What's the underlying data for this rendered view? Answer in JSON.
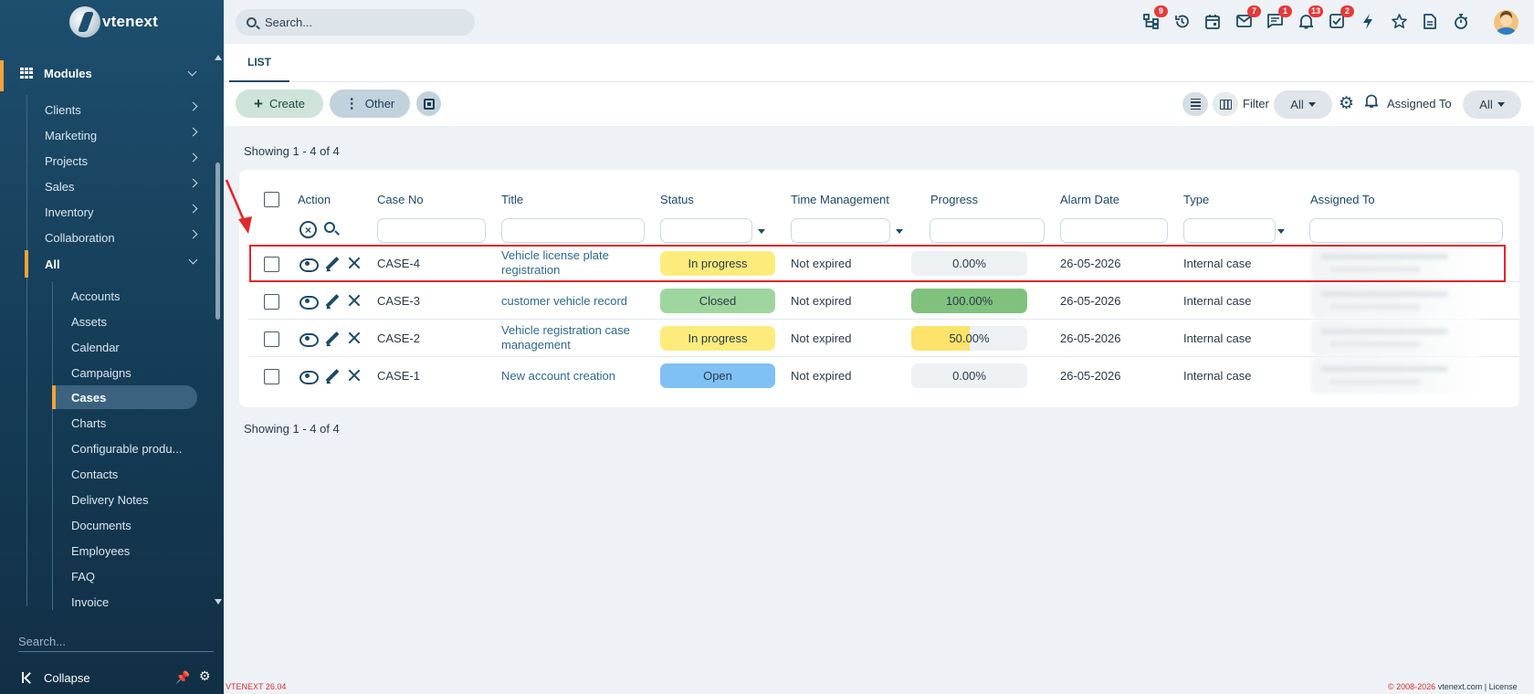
{
  "app": {
    "logo_text": "vtenext",
    "version": "VTENEXT 26.04",
    "copyright": "© 2008-2026",
    "site": "vtenext.com",
    "license": "License",
    "accent_color": "#f2a33a"
  },
  "sidebar": {
    "modules_label": "Modules",
    "items": [
      {
        "label": "Clients"
      },
      {
        "label": "Marketing"
      },
      {
        "label": "Projects"
      },
      {
        "label": "Sales"
      },
      {
        "label": "Inventory"
      },
      {
        "label": "Collaboration"
      },
      {
        "label": "All"
      }
    ],
    "sub_items": [
      {
        "label": "Accounts"
      },
      {
        "label": "Assets"
      },
      {
        "label": "Calendar"
      },
      {
        "label": "Campaigns"
      },
      {
        "label": "Cases"
      },
      {
        "label": "Charts"
      },
      {
        "label": "Configurable produ..."
      },
      {
        "label": "Contacts"
      },
      {
        "label": "Delivery Notes"
      },
      {
        "label": "Documents"
      },
      {
        "label": "Employees"
      },
      {
        "label": "FAQ"
      },
      {
        "label": "Invoice"
      }
    ],
    "active_sub_item": "Cases",
    "search_placeholder": "Search...",
    "collapse_label": "Collapse"
  },
  "topbar": {
    "search_placeholder": "Search...",
    "icons": [
      {
        "name": "hierarchy-icon",
        "badge": "9"
      },
      {
        "name": "history-icon",
        "badge": ""
      },
      {
        "name": "calendar-icon",
        "badge": ""
      },
      {
        "name": "mail-icon",
        "badge": "7"
      },
      {
        "name": "chat-icon",
        "badge": "1"
      },
      {
        "name": "bell-icon",
        "badge": "13"
      },
      {
        "name": "task-icon",
        "badge": "2"
      },
      {
        "name": "lightning-icon",
        "badge": ""
      },
      {
        "name": "star-icon",
        "badge": ""
      },
      {
        "name": "document-icon",
        "badge": ""
      },
      {
        "name": "timer-icon",
        "badge": ""
      }
    ]
  },
  "tabs": [
    {
      "label": "LIST"
    }
  ],
  "toolbar": {
    "create_label": "Create",
    "other_label": "Other",
    "filter_label": "Filter",
    "filter_value": "All",
    "assigned_to_label": "Assigned To",
    "assigned_to_value": "All"
  },
  "list": {
    "showing_top": "Showing 1 - 4 of 4",
    "showing_bottom": "Showing 1 - 4 of 4",
    "columns": {
      "action": "Action",
      "case_no": "Case No",
      "title": "Title",
      "status": "Status",
      "time_management": "Time Management",
      "progress": "Progress",
      "alarm_date": "Alarm Date",
      "type": "Type",
      "assigned_to": "Assigned To"
    },
    "rows": [
      {
        "case_no": "CASE-4",
        "title": "Vehicle license plate registration",
        "status": "In progress",
        "status_color": "#fdec7c",
        "time_management": "Not expired",
        "progress_text": "0.00%",
        "progress": 0,
        "progress_color": "#eef1f4",
        "alarm_date": "26-05-2026",
        "type": "Internal case"
      },
      {
        "case_no": "CASE-3",
        "title": "customer vehicle record",
        "status": "Closed",
        "status_color": "#9fd69f",
        "time_management": "Not expired",
        "progress_text": "100.00%",
        "progress": 100,
        "progress_color": "#80c17d",
        "alarm_date": "26-05-2026",
        "type": "Internal case"
      },
      {
        "case_no": "CASE-2",
        "title": "Vehicle registration case management",
        "status": "In progress",
        "status_color": "#fdec7c",
        "time_management": "Not expired",
        "progress_text": "50.00%",
        "progress": 50,
        "progress_color": "#fde36c",
        "alarm_date": "26-05-2026",
        "type": "Internal case"
      },
      {
        "case_no": "CASE-1",
        "title": "New account creation",
        "status": "Open",
        "status_color": "#7fc0f5",
        "time_management": "Not expired",
        "progress_text": "0.00%",
        "progress": 0,
        "progress_color": "#eef1f4",
        "alarm_date": "26-05-2026",
        "type": "Internal case"
      }
    ]
  }
}
